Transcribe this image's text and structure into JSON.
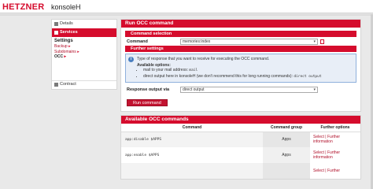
{
  "header": {
    "logo": "HETZNER",
    "app_name": "konsoleH"
  },
  "sidebar": {
    "items": [
      {
        "label": "Details"
      },
      {
        "label": "Services"
      }
    ],
    "settings_heading": "Settings",
    "links": [
      {
        "label": "Backup"
      },
      {
        "label": "Subdomains"
      },
      {
        "label": "OCC"
      }
    ],
    "contract_label": "Contract"
  },
  "occ_panel": {
    "title": "Run OCC command",
    "command_selection": "Command selection",
    "command_label": "Command",
    "command_value": "memories:index",
    "further_settings": "Further settings",
    "info_text": "Type of response that you want to receive for executing the OCC command.",
    "options_title": "Available options:",
    "option1_prefix": "mail to your mail address",
    "option1_code": "mail",
    "option2_prefix": "direct output here in konsoleH (we don't recommend this for long running commands)",
    "option2_code": "direct output",
    "response_label": "Response output via",
    "response_value": "direct output",
    "run_button": "Run command"
  },
  "available_panel": {
    "title": "Available OCC commands",
    "columns": [
      "Command",
      "Command group",
      "Further options"
    ],
    "rows": [
      {
        "command": "app:disable $APPS",
        "group": "Apps",
        "select": "Select",
        "sep": " | ",
        "info": "Further information"
      },
      {
        "command": "app:enable $APPS",
        "group": "Apps",
        "select": "Select",
        "sep": " | ",
        "info": "Further information"
      },
      {
        "command": "",
        "group": "",
        "select": "Select",
        "sep": " | ",
        "info": "Further"
      }
    ]
  }
}
